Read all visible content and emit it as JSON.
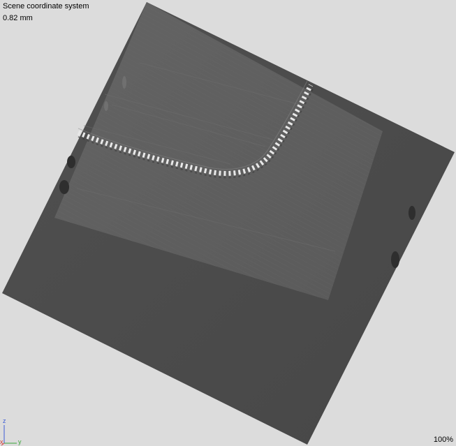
{
  "viewer": {
    "title": "Scene coordinate system",
    "scale_label": "0.82 mm",
    "zoom_label": "100%"
  },
  "axes": {
    "z_label": "z",
    "x_label": "x",
    "y_label": "y",
    "z_color": "#3b5bd6",
    "x_color": "#d43a3a",
    "y_color": "#3aa63a"
  },
  "colors": {
    "background": "#dcdcdc",
    "slab": "#4a4a4a",
    "scan": "#5c5c5c",
    "weld_highlight": "#e8e8e8"
  }
}
